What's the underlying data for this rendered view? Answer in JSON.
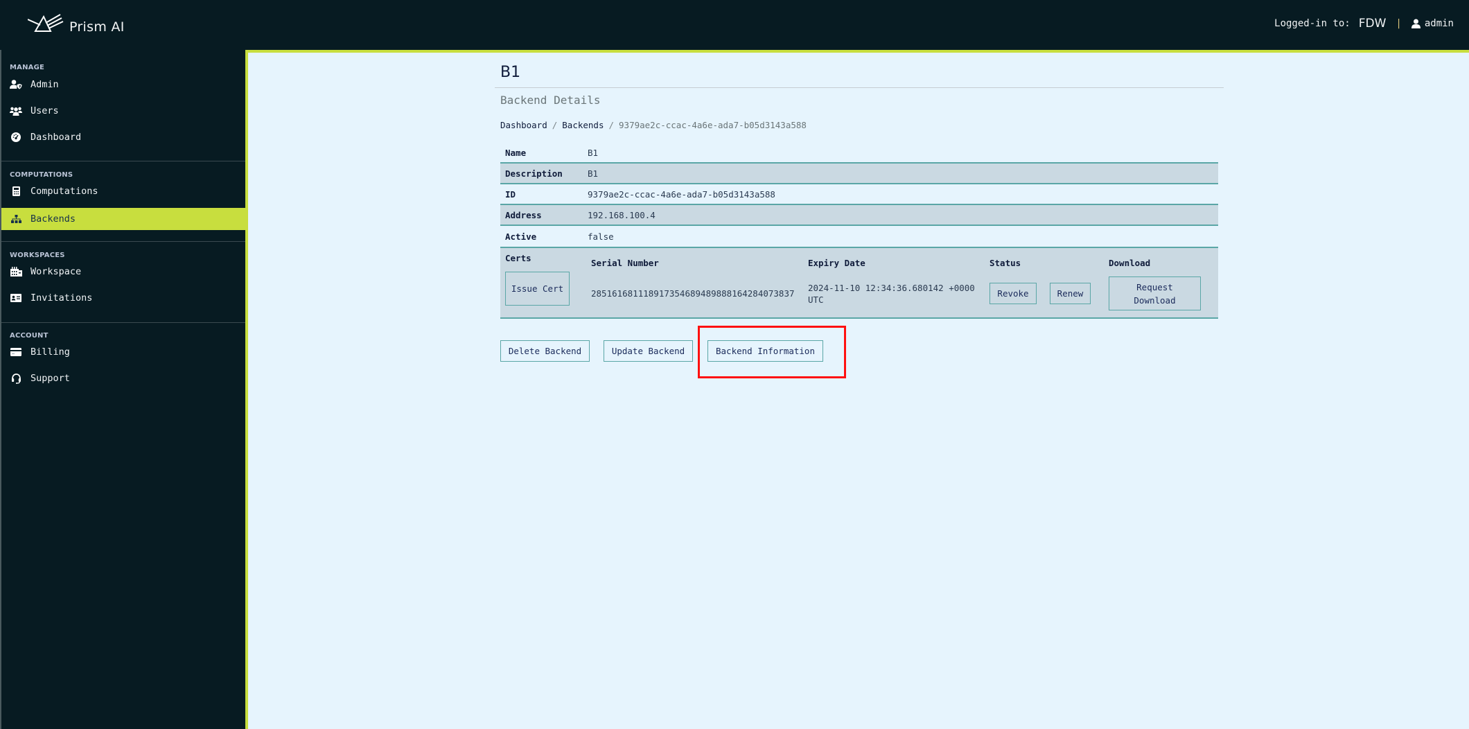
{
  "app": {
    "name": "Prism AI",
    "logo_icon": "prism-logo-icon"
  },
  "header": {
    "logged_in_label": "Logged-in to:",
    "organization": "FDW",
    "separator": "|",
    "user_icon": "user-icon",
    "username": "admin"
  },
  "sidebar": {
    "sections": [
      {
        "label": "MANAGE",
        "items": [
          {
            "label": "Admin",
            "icon": "user-shield-icon"
          },
          {
            "label": "Users",
            "icon": "users-icon"
          },
          {
            "label": "Dashboard",
            "icon": "gauge-icon"
          }
        ]
      },
      {
        "label": "COMPUTATIONS",
        "items": [
          {
            "label": "Computations",
            "icon": "calculator-icon"
          },
          {
            "label": "Backends",
            "icon": "sitemap-icon",
            "active": true
          }
        ]
      },
      {
        "label": "WORKSPACES",
        "items": [
          {
            "label": "Workspace",
            "icon": "industry-icon"
          },
          {
            "label": "Invitations",
            "icon": "id-card-icon"
          }
        ]
      },
      {
        "label": "ACCOUNT",
        "items": [
          {
            "label": "Billing",
            "icon": "credit-card-icon"
          },
          {
            "label": "Support",
            "icon": "headset-icon"
          }
        ]
      }
    ]
  },
  "page": {
    "title": "B1",
    "subtitle": "Backend Details",
    "breadcrumb": {
      "items": [
        "Dashboard",
        "Backends"
      ],
      "separator": "/",
      "current": "9379ae2c-ccac-4a6e-ada7-b05d3143a588"
    },
    "details": [
      {
        "key": "Name",
        "value": "B1"
      },
      {
        "key": "Description",
        "value": "B1"
      },
      {
        "key": "ID",
        "value": "9379ae2c-ccac-4a6e-ada7-b05d3143a588"
      },
      {
        "key": "Address",
        "value": "192.168.100.4"
      },
      {
        "key": "Active",
        "value": "false"
      }
    ],
    "certs": {
      "label": "Certs",
      "issue_button": "Issue Cert",
      "columns": [
        "Serial Number",
        "Expiry Date",
        "Status",
        "Download"
      ],
      "rows": [
        {
          "serial_number": "285161681118917354689489888164284073837",
          "expiry_date": "2024-11-10 12:34:36.680142 +0000 UTC",
          "status_actions": [
            "Revoke",
            "Renew"
          ],
          "download_action": "Request Download"
        }
      ]
    },
    "actions": {
      "delete": "Delete Backend",
      "update": "Update Backend",
      "information": "Backend Information"
    }
  },
  "colors": {
    "sidebar_bg": "#071b22",
    "accent": "#c8de3e",
    "main_bg": "#e6f4fd",
    "row_alt": "#cad9e2",
    "border_teal": "#5aa6a6",
    "highlight": "#ff1010"
  }
}
